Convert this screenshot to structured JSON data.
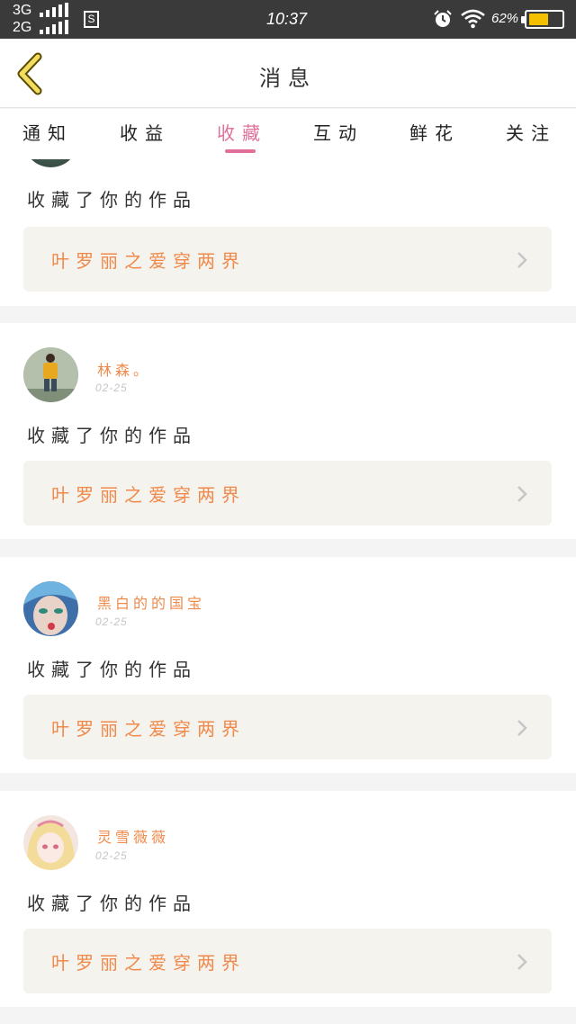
{
  "status_bar": {
    "network_1": "3G",
    "network_2": "2G",
    "sim_icon": "S",
    "time": "10:37",
    "battery_percent": "62%",
    "battery_level": 0.62
  },
  "header": {
    "title": "消息",
    "back_icon": "chevron-left-icon"
  },
  "tabs": [
    {
      "label": "通知",
      "active": false
    },
    {
      "label": "收益",
      "active": false
    },
    {
      "label": "收藏",
      "active": true
    },
    {
      "label": "互动",
      "active": false
    },
    {
      "label": "鲜花",
      "active": false
    },
    {
      "label": "关注",
      "active": false
    }
  ],
  "colors": {
    "accent": "#e0709a",
    "name_color": "#f0894a",
    "work_bg": "#f4f3ee"
  },
  "notifications": [
    {
      "user": "",
      "date": "",
      "action": "收藏了你的作品",
      "work": "叶罗丽之爱穿两界"
    },
    {
      "user": "林森。",
      "date": "02-25",
      "action": "收藏了你的作品",
      "work": "叶罗丽之爱穿两界"
    },
    {
      "user": "黑白的的国宝",
      "date": "02-25",
      "action": "收藏了你的作品",
      "work": "叶罗丽之爱穿两界"
    },
    {
      "user": "灵雪薇薇",
      "date": "02-25",
      "action": "收藏了你的作品",
      "work": "叶罗丽之爱穿两界"
    }
  ]
}
